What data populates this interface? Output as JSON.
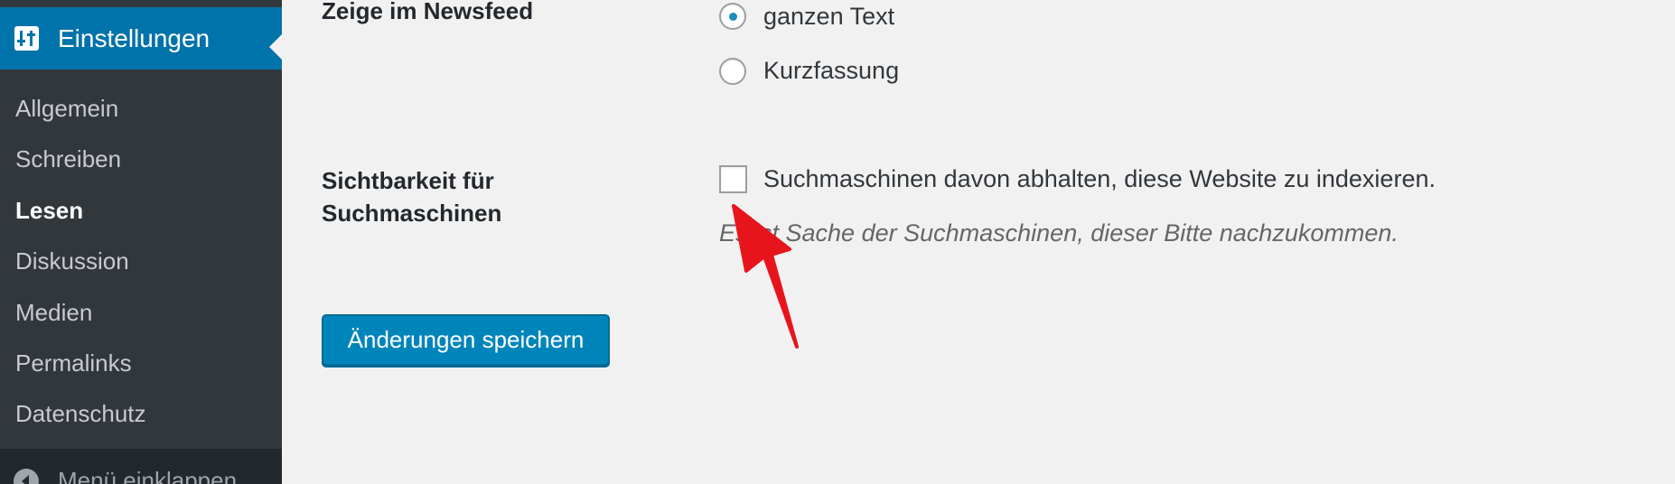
{
  "sidebar": {
    "menu_head": {
      "label": "Einstellungen",
      "icon": "settings-sliders-icon"
    },
    "items": [
      {
        "label": "Allgemein",
        "current": false
      },
      {
        "label": "Schreiben",
        "current": false
      },
      {
        "label": "Lesen",
        "current": true
      },
      {
        "label": "Diskussion",
        "current": false
      },
      {
        "label": "Medien",
        "current": false
      },
      {
        "label": "Permalinks",
        "current": false
      },
      {
        "label": "Datenschutz",
        "current": false
      }
    ],
    "collapse": {
      "label": "Menü einklappen",
      "icon": "collapse-arrow-icon"
    }
  },
  "settings": {
    "newsfeed": {
      "label": "Zeige im Newsfeed",
      "options": [
        {
          "label": "ganzen Text",
          "checked": true
        },
        {
          "label": "Kurzfassung",
          "checked": false
        }
      ]
    },
    "search_visibility": {
      "label_line1": "Sichtbarkeit für",
      "label_line2": "Suchmaschinen",
      "checkbox_label": "Suchmaschinen davon abhalten, diese Website zu indexieren.",
      "checked": false,
      "description": "Es ist Sache der Suchmaschinen, dieser Bitte nachzukommen."
    }
  },
  "save_button": {
    "label": "Änderungen speichern"
  },
  "colors": {
    "sidebar_bg": "#23282d",
    "submenu_bg": "#32373c",
    "accent": "#0073aa",
    "button": "#0085ba",
    "radio_dot": "#1e8cbe",
    "annotation_arrow": "#e8141c"
  },
  "annotation": {
    "icon": "red-pointer-arrow-icon"
  }
}
